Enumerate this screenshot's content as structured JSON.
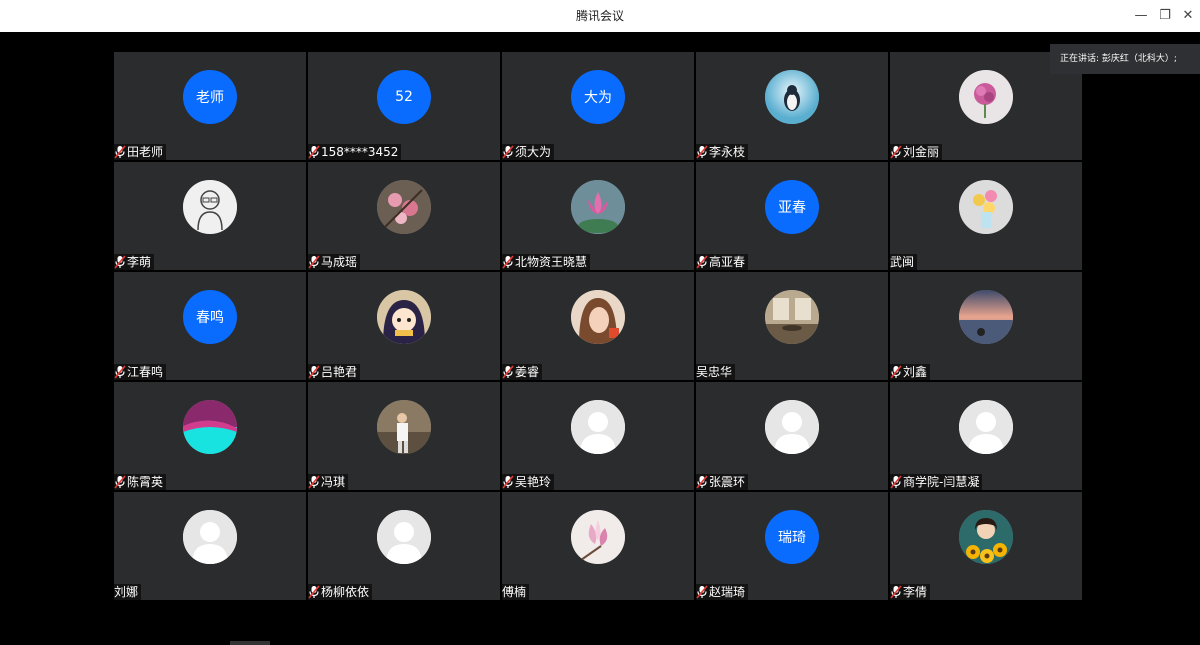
{
  "window": {
    "title": "腾讯会议",
    "minimize_glyph": "—",
    "restore_glyph": "❐",
    "close_glyph": "✕"
  },
  "speaking": "正在讲话: 彭庆红（北科大）;",
  "participants": [
    {
      "name": "田老师",
      "avatar": "text",
      "avatar_text": "老师",
      "muted": true
    },
    {
      "name": "158****3452",
      "avatar": "text",
      "avatar_text": "52",
      "muted": true
    },
    {
      "name": "须大为",
      "avatar": "text",
      "avatar_text": "大为",
      "muted": true
    },
    {
      "name": "李永枝",
      "avatar": "photo",
      "photo": "penguin",
      "muted": true
    },
    {
      "name": "刘金丽",
      "avatar": "photo",
      "photo": "pink-flower",
      "muted": true
    },
    {
      "name": "李萌",
      "avatar": "photo",
      "photo": "cartoon-sketch",
      "muted": true
    },
    {
      "name": "马成瑶",
      "avatar": "photo",
      "photo": "blossom",
      "muted": true
    },
    {
      "name": "北物资王晓慧",
      "avatar": "photo",
      "photo": "lotus",
      "muted": true
    },
    {
      "name": "高亚春",
      "avatar": "text",
      "avatar_text": "亚春",
      "muted": true
    },
    {
      "name": "武闽",
      "avatar": "photo",
      "photo": "flowers-vase",
      "muted": false
    },
    {
      "name": "江春鸣",
      "avatar": "text",
      "avatar_text": "春鸣",
      "muted": true
    },
    {
      "name": "吕艳君",
      "avatar": "photo",
      "photo": "anime-girl",
      "muted": true
    },
    {
      "name": "姜睿",
      "avatar": "photo",
      "photo": "woman-portrait",
      "muted": true
    },
    {
      "name": "吴忠华",
      "avatar": "photo",
      "photo": "room",
      "muted": false
    },
    {
      "name": "刘鑫",
      "avatar": "photo",
      "photo": "sunset-lake",
      "muted": true
    },
    {
      "name": "陈霄英",
      "avatar": "photo",
      "photo": "magenta-cyan",
      "muted": true
    },
    {
      "name": "冯琪",
      "avatar": "photo",
      "photo": "person-outdoor",
      "muted": true
    },
    {
      "name": "吴艳玲",
      "avatar": "placeholder",
      "muted": true
    },
    {
      "name": "张震环",
      "avatar": "placeholder",
      "muted": true
    },
    {
      "name": "商学院-闫慧凝",
      "avatar": "placeholder",
      "muted": true
    },
    {
      "name": "刘娜",
      "avatar": "placeholder",
      "muted": false
    },
    {
      "name": "杨柳依依",
      "avatar": "placeholder",
      "muted": true
    },
    {
      "name": "傅楠",
      "avatar": "photo",
      "photo": "magnolia",
      "muted": false
    },
    {
      "name": "赵瑞琦",
      "avatar": "text",
      "avatar_text": "瑞琦",
      "muted": true
    },
    {
      "name": "李倩",
      "avatar": "photo",
      "photo": "girl-sunflowers",
      "muted": true
    }
  ],
  "colors": {
    "text_avatar_bg": "#0a6cff",
    "tile_bg": "#2b2c2e",
    "window_bg": "#000000"
  }
}
